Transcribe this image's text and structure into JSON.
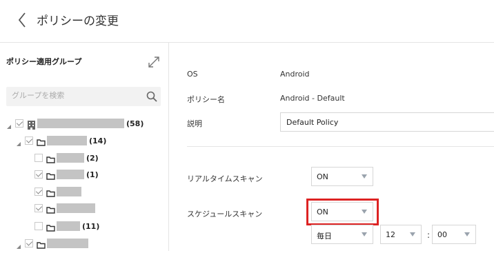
{
  "header": {
    "title": "ポリシーの変更"
  },
  "sidebar": {
    "title": "ポリシー適用グループ",
    "search_placeholder": "グループを検索",
    "tree": [
      {
        "count": "(58)"
      },
      {
        "count": "(14)"
      },
      {
        "count": "(2)"
      },
      {
        "count": "(1)"
      },
      {
        "count": ""
      },
      {
        "count": ""
      },
      {
        "count": "(11)"
      },
      {
        "count": ""
      }
    ]
  },
  "policy": {
    "os_label": "OS",
    "os_value": "Android",
    "name_label": "ポリシー名",
    "name_value": "Android - Default",
    "desc_label": "説明",
    "desc_value": "Default Policy",
    "realtime_label": "リアルタイムスキャン",
    "realtime_value": "ON",
    "scheduled_label": "スケジュールスキャン",
    "scheduled_value": "ON",
    "frequency_value": "毎日",
    "hour_value": "12",
    "minute_value": "00",
    "time_separator": ":"
  }
}
